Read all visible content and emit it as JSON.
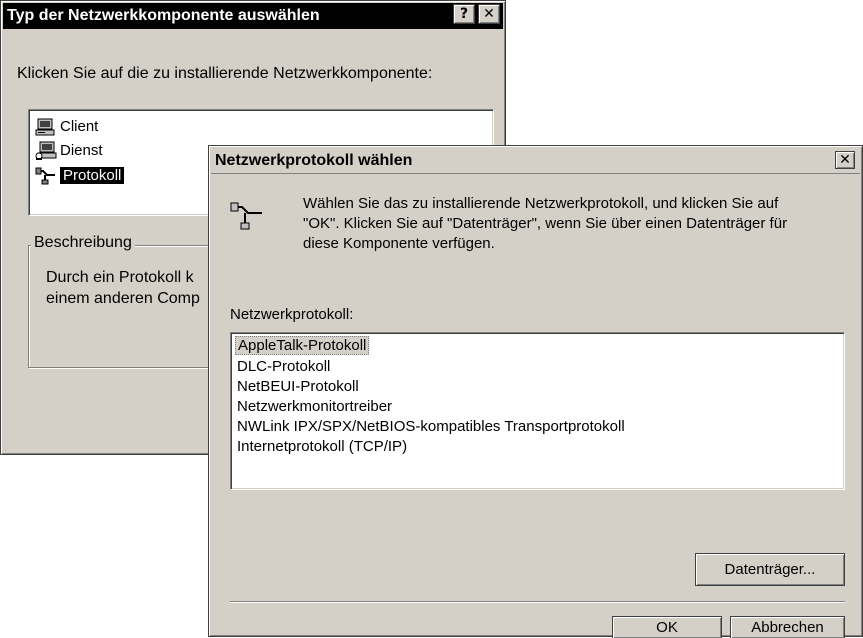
{
  "back_dialog": {
    "title": "Typ der Netzwerkkomponente auswählen",
    "help_glyph": "?",
    "close_glyph": "✕",
    "instruction": "Klicken Sie auf die zu installierende Netzwerkkomponente:",
    "components": [
      {
        "label": "Client",
        "icon": "computer-icon"
      },
      {
        "label": "Dienst",
        "icon": "service-computer-icon"
      },
      {
        "label": "Protokoll",
        "icon": "network-plug-icon",
        "selected": true
      }
    ],
    "description_label": "Beschreibung",
    "description_line1": "Durch ein Protokoll k",
    "description_line2": "einem anderen Comp"
  },
  "front_dialog": {
    "title": "Netzwerkprotokoll wählen",
    "close_glyph": "✕",
    "intro_line1": "Wählen Sie das zu installierende Netzwerkprotokoll, und klicken Sie auf",
    "intro_line2": "\"OK\". Klicken Sie auf \"Datenträger\", wenn Sie über einen Datenträger für",
    "intro_line3": "diese Komponente verfügen.",
    "list_label": "Netzwerkprotokoll:",
    "protocols": [
      "AppleTalk-Protokoll",
      "DLC-Protokoll",
      "NetBEUI-Protokoll",
      "Netzwerkmonitortreiber",
      "NWLink IPX/SPX/NetBIOS-kompatibles Transportprotokoll",
      "Internetprotokoll (TCP/IP)"
    ],
    "selected_protocol": "AppleTalk-Protokoll",
    "disk_button": "Datenträger...",
    "ok_button": "OK",
    "cancel_button": "Abbrechen"
  }
}
